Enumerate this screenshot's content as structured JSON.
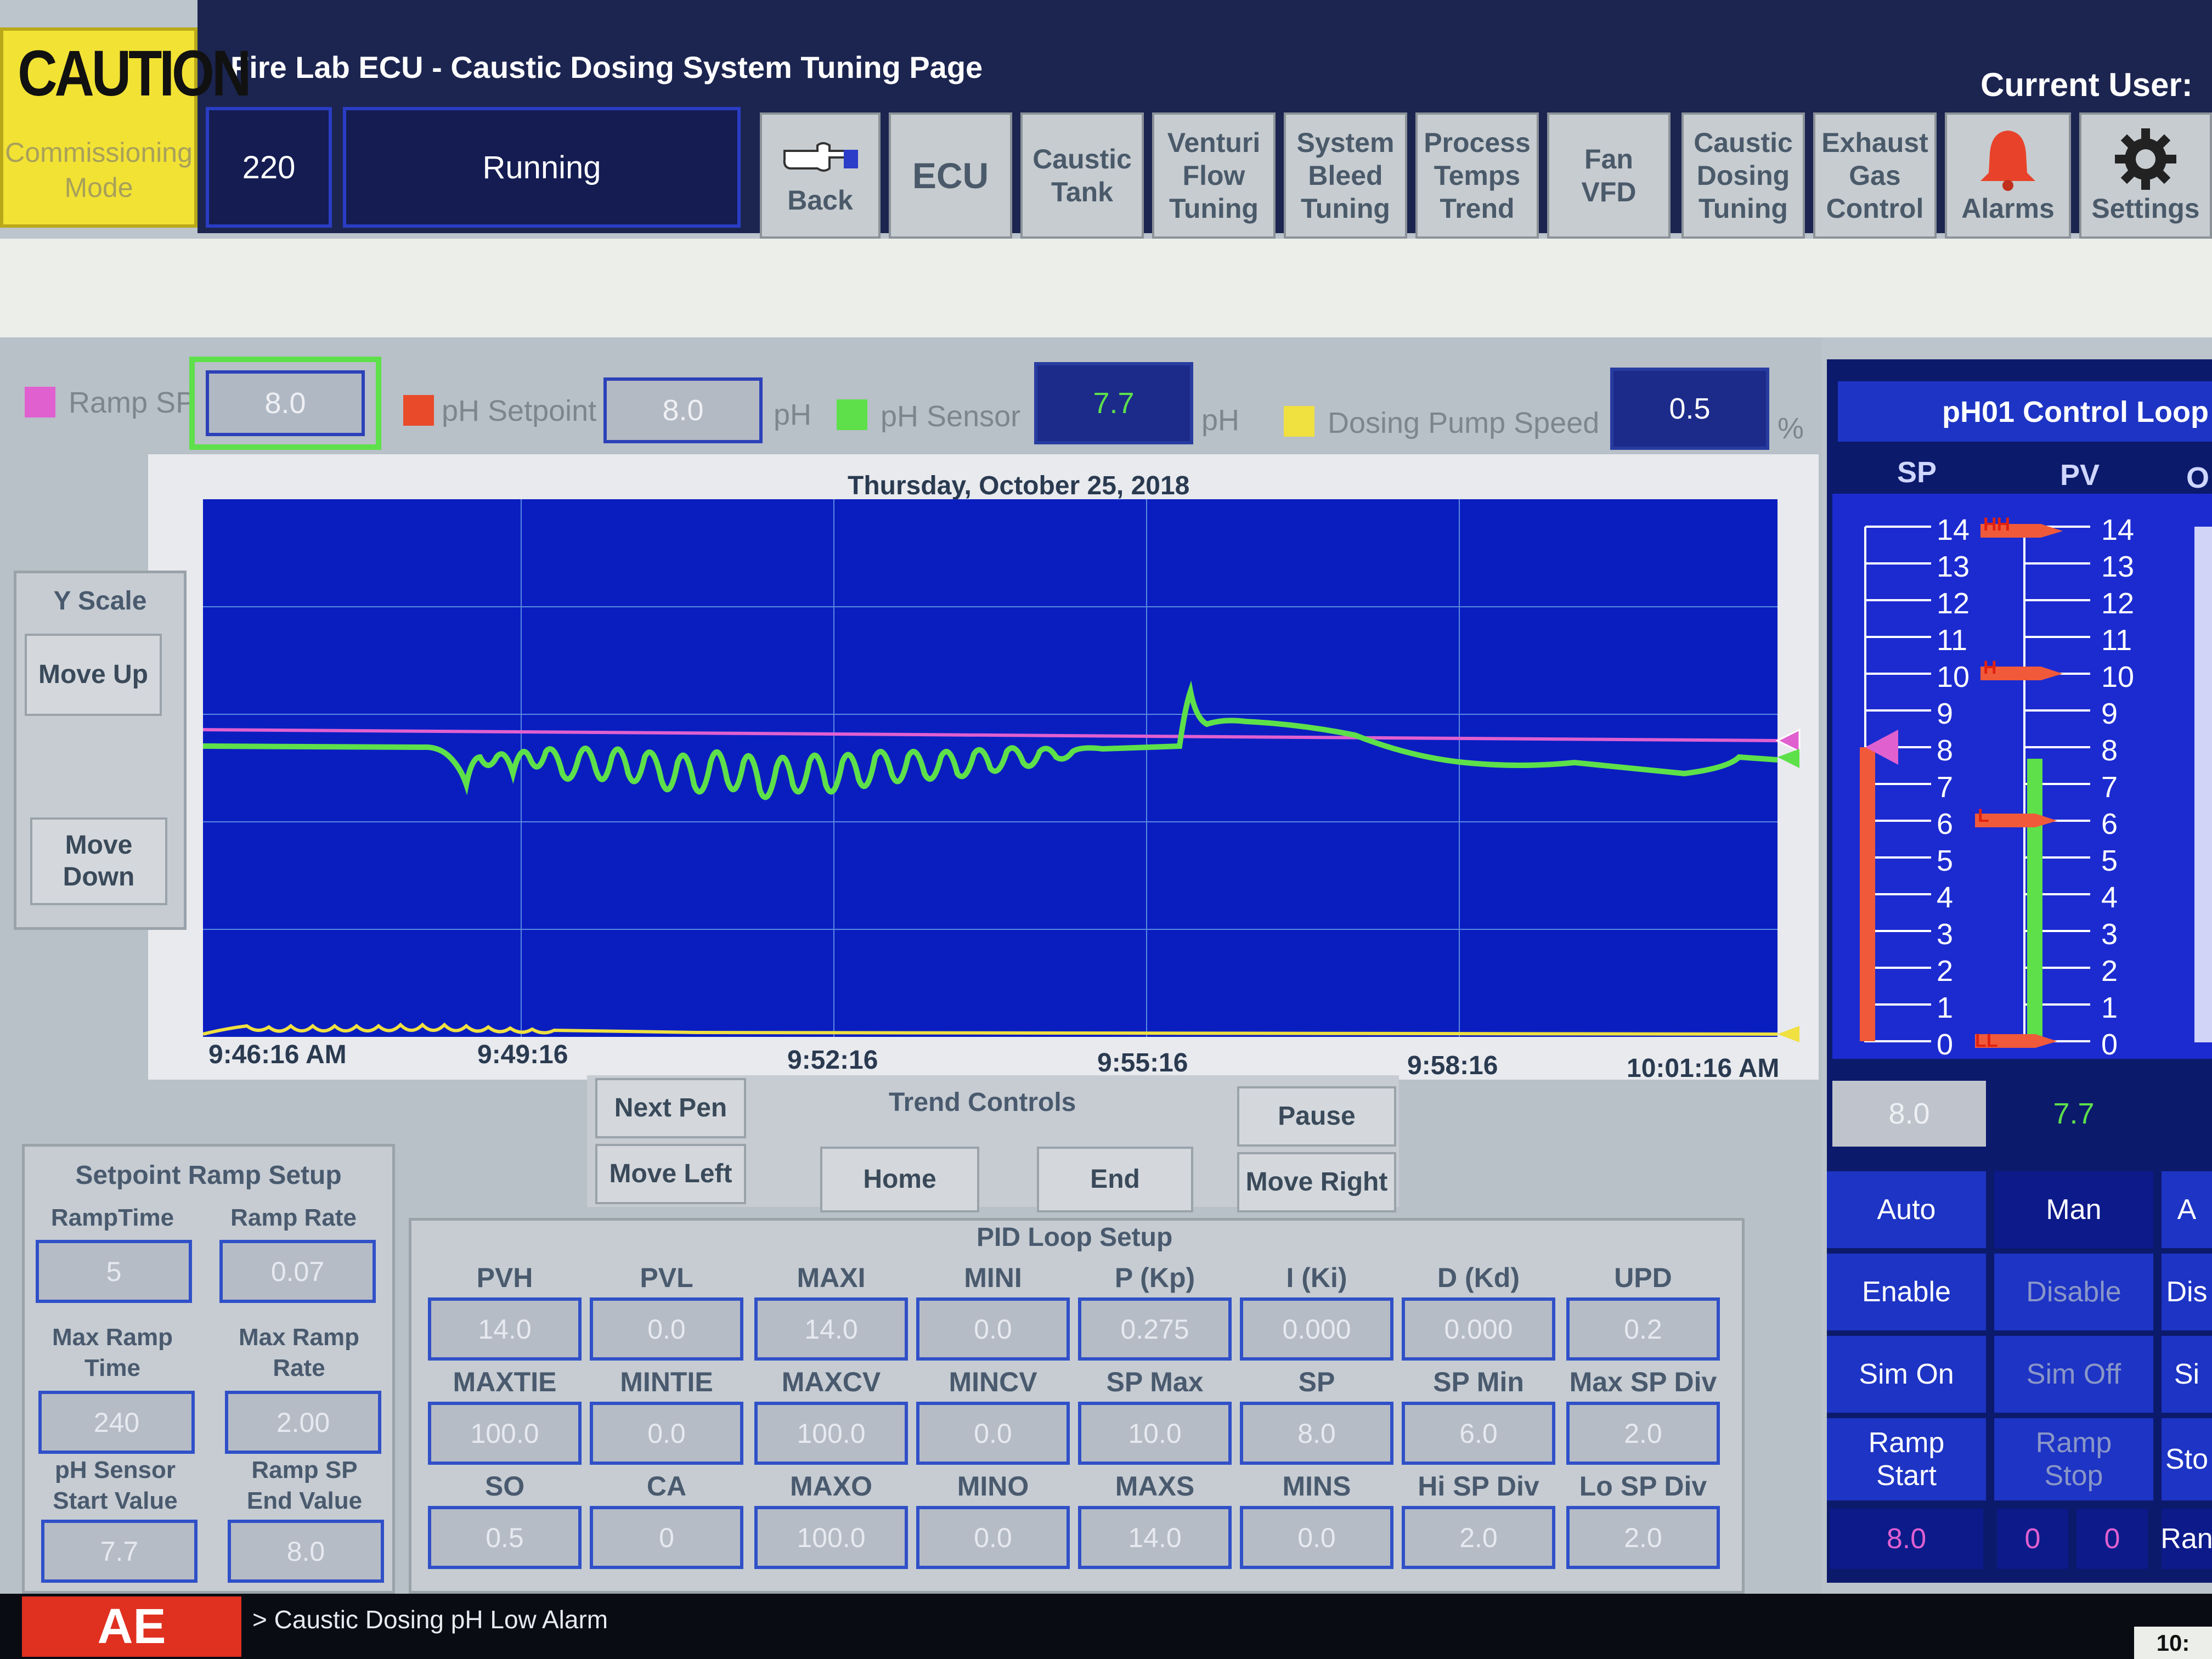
{
  "caution": {
    "word": "CAUTION",
    "mode_line1": "Commissioning",
    "mode_line2": "Mode"
  },
  "header": {
    "title": "Fire Lab ECU -  Caustic Dosing System Tuning Page",
    "current_user_label": "Current User:"
  },
  "status": {
    "code": "220",
    "state": "Running"
  },
  "nav": {
    "back": "Back",
    "items": [
      {
        "label": "ECU"
      },
      {
        "label": "Caustic\nTank"
      },
      {
        "label": "Venturi\nFlow\nTuning"
      },
      {
        "label": "System\nBleed\nTuning"
      },
      {
        "label": "Process\nTemps\nTrend"
      },
      {
        "label": "Fan\nVFD"
      },
      {
        "label": "Caustic\nDosing\nTuning"
      },
      {
        "label": "Exhaust\nGas\nControl"
      }
    ],
    "alarms": "Alarms",
    "settings": "Settings"
  },
  "legend": {
    "ramp_sp": {
      "label": "Ramp SP",
      "value": "8.0",
      "color": "#e060d0"
    },
    "ph_setpoint": {
      "label": "pH Setpoint",
      "value": "8.0",
      "unit": "pH",
      "color": "#e84a2a"
    },
    "ph_sensor": {
      "label": "pH Sensor",
      "value": "7.7",
      "unit": "pH",
      "color": "#5ee04a"
    },
    "dosing_pump": {
      "label": "Dosing Pump Speed",
      "value": "0.5",
      "unit": "%",
      "color": "#f0e040"
    }
  },
  "trend": {
    "date": "Thursday, October 25, 2018",
    "time_labels": [
      "9:46:16 AM",
      "9:49:16",
      "9:52:16",
      "9:55:16",
      "9:58:16",
      "10:01:16 AM"
    ]
  },
  "yscale": {
    "title": "Y Scale",
    "up": "Move Up",
    "down": "Move\nDown"
  },
  "trend_controls": {
    "title": "Trend Controls",
    "next_pen": "Next Pen",
    "move_left": "Move Left",
    "home": "Home",
    "end": "End",
    "pause": "Pause",
    "move_right": "Move Right"
  },
  "ramp_setup": {
    "title": "Setpoint Ramp Setup",
    "ramp_time": {
      "label": "RampTime",
      "value": "5"
    },
    "ramp_rate": {
      "label": "Ramp Rate",
      "value": "0.07"
    },
    "max_ramp_time": {
      "label": "Max Ramp\nTime",
      "value": "240"
    },
    "max_ramp_rate": {
      "label": "Max Ramp\nRate",
      "value": "2.00"
    },
    "ph_start": {
      "label": "pH Sensor\nStart Value",
      "value": "7.7"
    },
    "ramp_end": {
      "label": "Ramp SP\nEnd Value",
      "value": "8.0"
    }
  },
  "pid": {
    "title": "PID Loop Setup",
    "rows": [
      [
        {
          "label": "PVH",
          "value": "14.0"
        },
        {
          "label": "PVL",
          "value": "0.0"
        },
        {
          "label": "MAXI",
          "value": "14.0"
        },
        {
          "label": "MINI",
          "value": "0.0"
        },
        {
          "label": "P (Kp)",
          "value": "0.275"
        },
        {
          "label": "I (Ki)",
          "value": "0.000"
        },
        {
          "label": "D (Kd)",
          "value": "0.000"
        },
        {
          "label": "UPD",
          "value": "0.2"
        }
      ],
      [
        {
          "label": "MAXTIE",
          "value": "100.0"
        },
        {
          "label": "MINTIE",
          "value": "0.0"
        },
        {
          "label": "MAXCV",
          "value": "100.0"
        },
        {
          "label": "MINCV",
          "value": "0.0"
        },
        {
          "label": "SP Max",
          "value": "10.0"
        },
        {
          "label": "SP",
          "value": "8.0"
        },
        {
          "label": "SP Min",
          "value": "6.0"
        },
        {
          "label": "Max SP Div",
          "value": "2.0"
        }
      ],
      [
        {
          "label": "SO",
          "value": "0.5"
        },
        {
          "label": "CA",
          "value": "0"
        },
        {
          "label": "MAXO",
          "value": "100.0"
        },
        {
          "label": "MINO",
          "value": "0.0"
        },
        {
          "label": "MAXS",
          "value": "14.0"
        },
        {
          "label": "MINS",
          "value": "0.0"
        },
        {
          "label": "Hi SP Div",
          "value": "2.0"
        },
        {
          "label": "Lo SP Div",
          "value": "2.0"
        }
      ]
    ]
  },
  "loop": {
    "title": "pH01 Control Loop",
    "col_sp": "SP",
    "col_pv": "PV",
    "col_o": "O",
    "scale": [
      "14",
      "13",
      "12",
      "11",
      "10",
      "9",
      "8",
      "7",
      "6",
      "5",
      "4",
      "3",
      "2",
      "1",
      "0"
    ],
    "hh": "HH",
    "h": "H",
    "l": "L",
    "ll": "LL",
    "sp_value": "8.0",
    "pv_value": "7.7",
    "auto": "Auto",
    "man": "Man",
    "a_cut": "A",
    "enable": "Enable",
    "disable": "Disable",
    "dis_cut": "Dis",
    "sim_on": "Sim On",
    "sim_off": "Sim Off",
    "sim_cut": "Si",
    "ramp_start": "Ramp\nStart",
    "ramp_stop": "Ramp\nStop",
    "sto_cut": "Sto",
    "ramp_sp_val": "8.0",
    "count1": "0",
    "count2": "0",
    "ran_cut": "Ran"
  },
  "footer": {
    "logo": "AE",
    "alarm_text": "> Caustic Dosing pH Low Alarm",
    "time_cut": "10:"
  }
}
